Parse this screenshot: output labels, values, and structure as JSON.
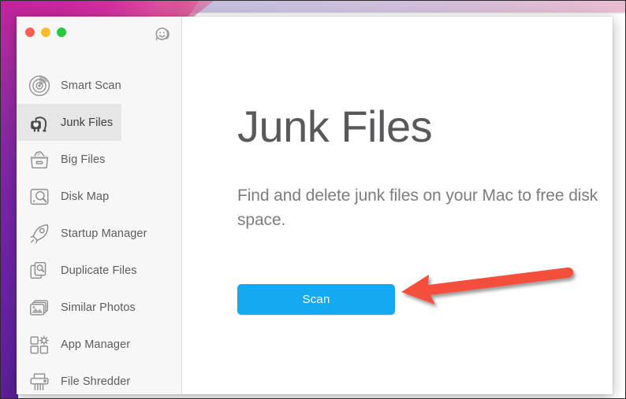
{
  "window": {
    "traffic_lights": [
      {
        "name": "close",
        "color": "#ff5f57"
      },
      {
        "name": "minimize",
        "color": "#ffbd2e"
      },
      {
        "name": "zoom",
        "color": "#28c840"
      }
    ],
    "support_icon": "smiley-headset-icon"
  },
  "sidebar": {
    "items": [
      {
        "label": "Smart Scan",
        "icon": "radar-icon",
        "selected": false
      },
      {
        "label": "Junk Files",
        "icon": "vacuum-icon",
        "selected": true
      },
      {
        "label": "Big Files",
        "icon": "storage-box-icon",
        "selected": false
      },
      {
        "label": "Disk Map",
        "icon": "disk-magnifier-icon",
        "selected": false
      },
      {
        "label": "Startup Manager",
        "icon": "rocket-icon",
        "selected": false
      },
      {
        "label": "Duplicate Files",
        "icon": "copies-search-icon",
        "selected": false
      },
      {
        "label": "Similar Photos",
        "icon": "photos-stack-icon",
        "selected": false
      },
      {
        "label": "App Manager",
        "icon": "apps-gear-icon",
        "selected": false
      },
      {
        "label": "File Shredder",
        "icon": "shredder-icon",
        "selected": false
      }
    ]
  },
  "main": {
    "title": "Junk Files",
    "description": "Find and delete junk files on your Mac to free disk space.",
    "scan_button_label": "Scan"
  },
  "annotation": {
    "arrow": "red-left-arrow",
    "color": "#f4503c"
  },
  "colors": {
    "accent_button": "#14a9f0",
    "sidebar_background": "#f7f7f7",
    "selected_row": "#e6e6e6",
    "title_text": "#59595b",
    "description_text": "#7d7d80"
  }
}
